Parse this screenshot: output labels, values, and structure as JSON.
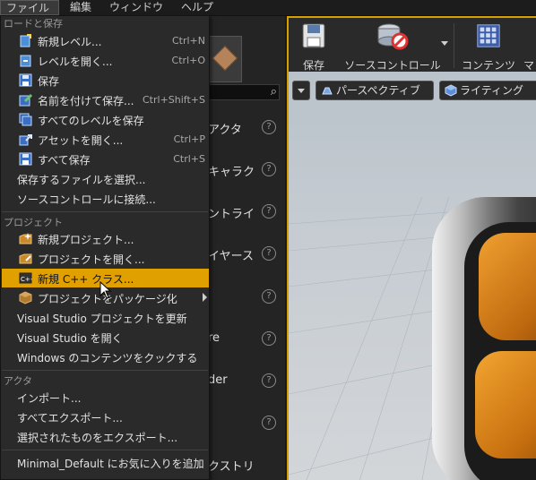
{
  "menubar": {
    "items": [
      "ファイル",
      "編集",
      "ウィンドウ",
      "ヘルプ"
    ]
  },
  "left_panel": {
    "place_items": [
      "アクタ",
      "キャラク",
      "ントライ",
      "イヤース",
      "re",
      "der",
      "クストリ"
    ]
  },
  "toolbar": {
    "save_label": "保存",
    "source_control_label": "ソースコントロール",
    "content_label": "コンテンツ",
    "cut_label": "マ"
  },
  "viewport": {
    "perspective_label": "パースペクティブ",
    "lighting_label": "ライティング"
  },
  "file_menu": {
    "sections": {
      "load_save": "ロードと保存",
      "project": "プロジェクト",
      "actor": "アクタ"
    },
    "items": [
      {
        "label": "新規レベル...",
        "shortcut": "Ctrl+N",
        "icon": "new-level-icon"
      },
      {
        "label": "レベルを開く...",
        "shortcut": "Ctrl+O",
        "icon": "open-level-icon"
      },
      {
        "label": "保存",
        "shortcut": "",
        "icon": "save-icon"
      },
      {
        "label": "名前を付けて保存...",
        "shortcut": "Ctrl+Shift+S",
        "icon": "save-as-icon"
      },
      {
        "label": "すべてのレベルを保存",
        "shortcut": "",
        "icon": "save-all-levels-icon"
      },
      {
        "label": "アセットを開く...",
        "shortcut": "Ctrl+P",
        "icon": "open-asset-icon"
      },
      {
        "label": "すべて保存",
        "shortcut": "Ctrl+S",
        "icon": "save-all-icon"
      },
      {
        "label": "保存するファイルを選択...",
        "shortcut": "",
        "icon": ""
      },
      {
        "label": "ソースコントロールに接続...",
        "shortcut": "",
        "icon": ""
      }
    ],
    "project_items": [
      {
        "label": "新規プロジェクト...",
        "icon": "new-project-icon"
      },
      {
        "label": "プロジェクトを開く...",
        "icon": "open-project-icon"
      },
      {
        "label": "新規 C++ クラス...",
        "icon": "cpp-class-icon"
      },
      {
        "label": "プロジェクトをパッケージ化",
        "icon": "package-icon"
      },
      {
        "label": "Visual Studio プロジェクトを更新",
        "icon": ""
      },
      {
        "label": "Visual Studio を開く",
        "icon": ""
      },
      {
        "label": "Windows のコンテンツをクックする",
        "icon": ""
      }
    ],
    "actor_items": [
      {
        "label": "インポート..."
      },
      {
        "label": "すべてエクスポート..."
      },
      {
        "label": "選択されたものをエクスポート..."
      }
    ],
    "favorite_item": "Minimal_Default にお気に入りを追加"
  },
  "colors": {
    "accent": "#e0a000",
    "menu_bg": "#2a2a2a"
  }
}
